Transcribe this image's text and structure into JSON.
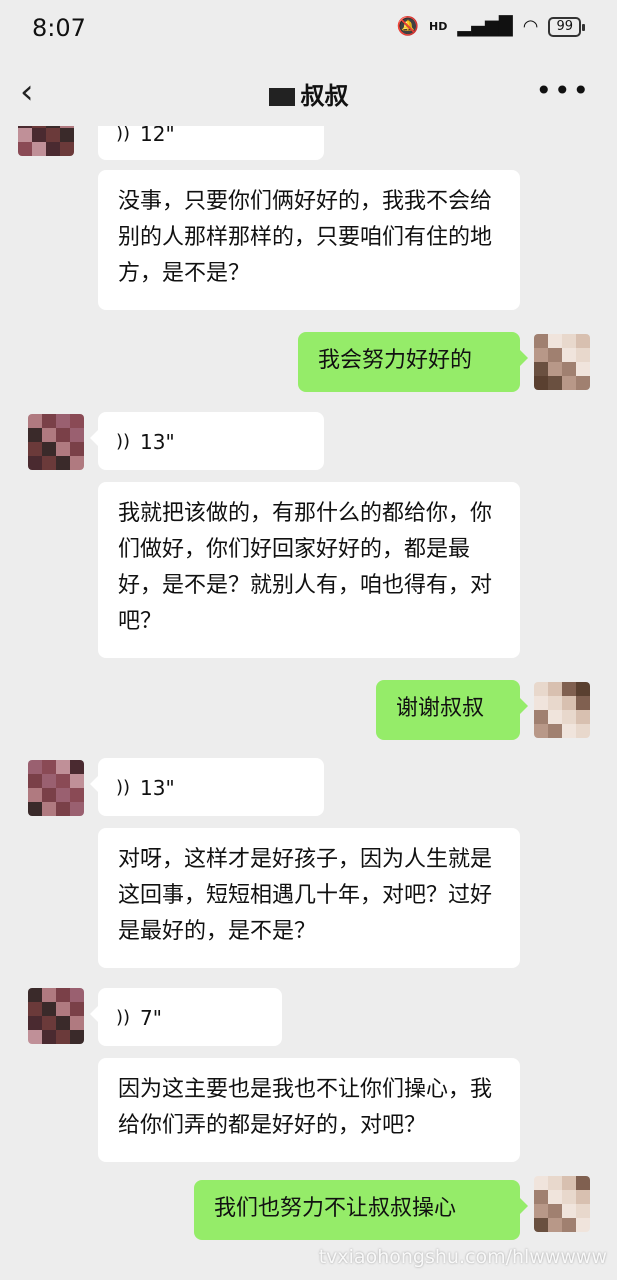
{
  "status_bar": {
    "time": "8:07",
    "network": "HD",
    "battery": "99"
  },
  "header": {
    "title": "叔叔",
    "back_icon": "chevron-left-icon",
    "more_icon": "more-horizontal-icon"
  },
  "messages": [
    {
      "type": "voice",
      "side": "in",
      "duration": "12\""
    },
    {
      "type": "text",
      "side": "in",
      "text": "没事，只要你们俩好好的，我我不会给别的人那样那样的，只要咱们有住的地方，是不是？"
    },
    {
      "type": "text",
      "side": "out",
      "text": "我会努力好好的"
    },
    {
      "type": "voice",
      "side": "in",
      "duration": "13\""
    },
    {
      "type": "text",
      "side": "in",
      "text": "我就把该做的，有那什么的都给你，你们做好，你们好回家好好的，都是最好，是不是？就别人有，咱也得有，对吧？"
    },
    {
      "type": "text",
      "side": "out",
      "text": "谢谢叔叔"
    },
    {
      "type": "voice",
      "side": "in",
      "duration": "13\""
    },
    {
      "type": "text",
      "side": "in",
      "text": "对呀，这样才是好孩子，因为人生就是这回事，短短相遇几十年，对吧？过好是最好的，是不是？"
    },
    {
      "type": "voice",
      "side": "in",
      "duration": "7\""
    },
    {
      "type": "text",
      "side": "in",
      "text": "因为这主要也是我也不让你们操心，我给你们弄的都是好好的，对吧？"
    },
    {
      "type": "text",
      "side": "out",
      "text": "我们也努力不让叔叔操心"
    }
  ],
  "watermark": "tvxiaohongshu.com/hlwwwww",
  "colors": {
    "background": "#ededed",
    "incoming_bubble": "#ffffff",
    "outgoing_bubble": "#95ec69"
  }
}
